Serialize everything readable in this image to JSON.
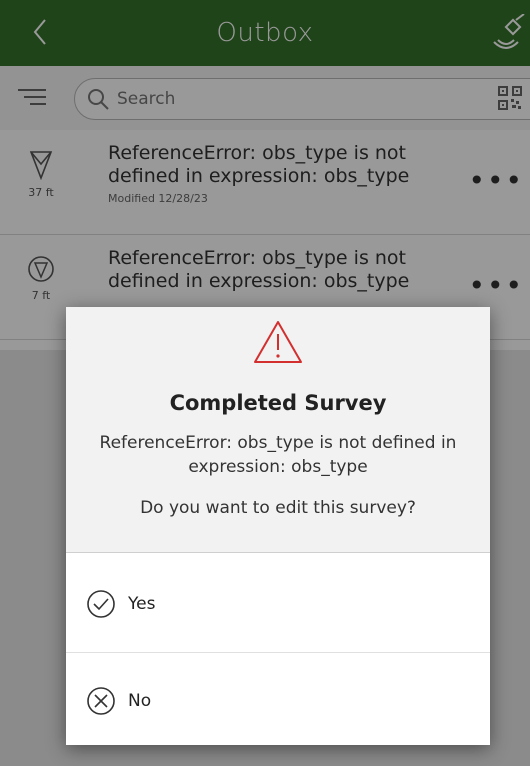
{
  "header": {
    "title": "Outbox",
    "back_icon": "chevron-left-icon",
    "right_icon": "satellite-icon",
    "color": "#35722b"
  },
  "search": {
    "placeholder": "Search",
    "filter_icon": "filter-lines-icon",
    "qr_icon": "qr-code-icon"
  },
  "outbox": {
    "items": [
      {
        "message": "ReferenceError: obs_type is not defined in expression: obs_type",
        "modified": "Modified 12/28/23",
        "distance": "37 ft",
        "icon": "location-arrow-icon"
      },
      {
        "message": "ReferenceError: obs_type is not defined in expression: obs_type",
        "distance": "7 ft",
        "icon": "location-arrow-circle-icon"
      }
    ]
  },
  "dialog": {
    "icon": "warning-triangle-icon",
    "title": "Completed Survey",
    "message": "ReferenceError: obs_type is not defined in expression: obs_type",
    "question": "Do you want to edit this survey?",
    "yes_label": "Yes",
    "no_label": "No",
    "warning_color": "#d32f2f"
  }
}
